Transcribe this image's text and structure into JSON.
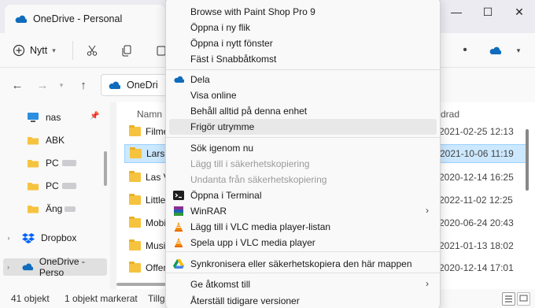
{
  "window": {
    "tab_title": "OneDrive - Personal",
    "controls": [
      "—",
      "☐",
      "✕"
    ]
  },
  "toolbar": {
    "new_label": "Nytt"
  },
  "address": {
    "path": "OneDri"
  },
  "sidebar": {
    "items": [
      {
        "label": "nas"
      },
      {
        "label": "ABK"
      },
      {
        "label": "PC"
      },
      {
        "label": "PC"
      },
      {
        "label": "Äng"
      },
      {
        "label": "Dropbox"
      },
      {
        "label": "OneDrive - Perso"
      }
    ]
  },
  "files": {
    "col_name": "Namn",
    "col_date": "drad",
    "rows": [
      {
        "name": "Filme",
        "date": "2021-02-25 12:13"
      },
      {
        "name": "Lars-C",
        "date": "2021-10-06 11:19"
      },
      {
        "name": "Las Ve",
        "date": "2020-12-14 16:25"
      },
      {
        "name": "Little",
        "date": "2022-11-02 12:25"
      },
      {
        "name": "Mobil",
        "date": "2020-06-24 20:43"
      },
      {
        "name": "Musik",
        "date": "2021-01-13 18:02"
      },
      {
        "name": "Offen",
        "date": "2020-12-14 17:01"
      }
    ]
  },
  "status": {
    "count": "41 objekt",
    "selected": "1 objekt markerat",
    "avail": "Tillgä"
  },
  "menu": {
    "items": [
      {
        "label": "Browse with Paint Shop Pro 9"
      },
      {
        "label": "Öppna i ny flik"
      },
      {
        "label": "Öppna i nytt fönster"
      },
      {
        "label": "Fäst i Snabbåtkomst"
      },
      {
        "label": "Dela",
        "icon": "onedrive-icon"
      },
      {
        "label": "Visa online"
      },
      {
        "label": "Behåll alltid på denna enhet"
      },
      {
        "label": "Frigör utrymme"
      },
      {
        "label": "Sök igenom nu"
      },
      {
        "label": "Lägg till i säkerhetskopiering"
      },
      {
        "label": "Undanta från säkerhetskopiering"
      },
      {
        "label": "Öppna i Terminal",
        "icon": "terminal-icon"
      },
      {
        "label": "WinRAR",
        "icon": "winrar-icon",
        "submenu": "›"
      },
      {
        "label": "Lägg till i VLC media player-listan",
        "icon": "vlc-icon"
      },
      {
        "label": "Spela upp i VLC media player",
        "icon": "vlc-icon"
      },
      {
        "label": "Synkronisera eller säkerhetskopiera den här mappen",
        "icon": "google-drive-icon"
      },
      {
        "label": "Ge åtkomst till",
        "submenu": "›"
      },
      {
        "label": "Återställ tidigare versioner"
      }
    ]
  },
  "colors": {
    "selection": "#cce8ff",
    "folder": "#f6c33f",
    "onedrive": "#0f6cbd"
  }
}
